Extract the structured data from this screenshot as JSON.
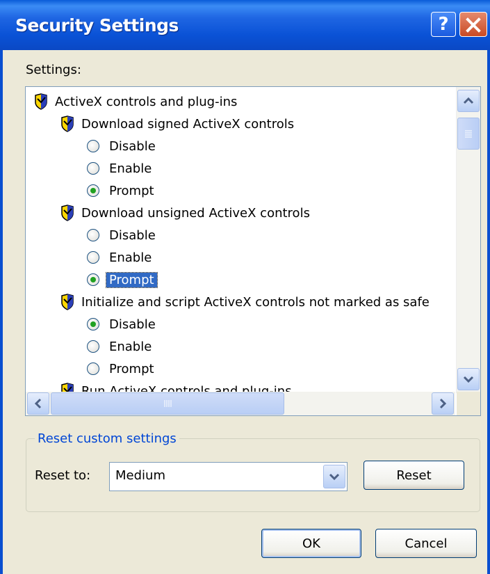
{
  "window": {
    "title": "Security Settings",
    "help_glyph": "?",
    "colors": {
      "titlebar": "#0a52d6",
      "face": "#ece9d8",
      "selection": "#316ac5",
      "groupbox_label": "#0046d5"
    }
  },
  "settings_label": "Settings:",
  "tree": {
    "root_label": "ActiveX controls and plug-ins",
    "items": [
      {
        "label": "Download signed ActiveX controls",
        "options": [
          {
            "label": "Disable",
            "checked": false
          },
          {
            "label": "Enable",
            "checked": false
          },
          {
            "label": "Prompt",
            "checked": true
          }
        ]
      },
      {
        "label": "Download unsigned ActiveX controls",
        "options": [
          {
            "label": "Disable",
            "checked": false
          },
          {
            "label": "Enable",
            "checked": false
          },
          {
            "label": "Prompt",
            "checked": true,
            "selected": true
          }
        ]
      },
      {
        "label": "Initialize and script ActiveX controls not marked as safe",
        "options": [
          {
            "label": "Disable",
            "checked": true
          },
          {
            "label": "Enable",
            "checked": false
          },
          {
            "label": "Prompt",
            "checked": false
          }
        ]
      },
      {
        "label": "Run ActiveX controls and plug-ins",
        "partially_visible": true
      }
    ]
  },
  "reset_group": {
    "legend": "Reset custom settings",
    "reset_to_label": "Reset to:",
    "reset_to_value": "Medium",
    "reset_button": "Reset"
  },
  "footer": {
    "ok_label": "OK",
    "cancel_label": "Cancel"
  },
  "icons": [
    "help-icon",
    "close-icon",
    "shield-icon",
    "scroll-up-icon",
    "scroll-down-icon",
    "scroll-left-icon",
    "scroll-right-icon",
    "chevron-down-icon"
  ]
}
